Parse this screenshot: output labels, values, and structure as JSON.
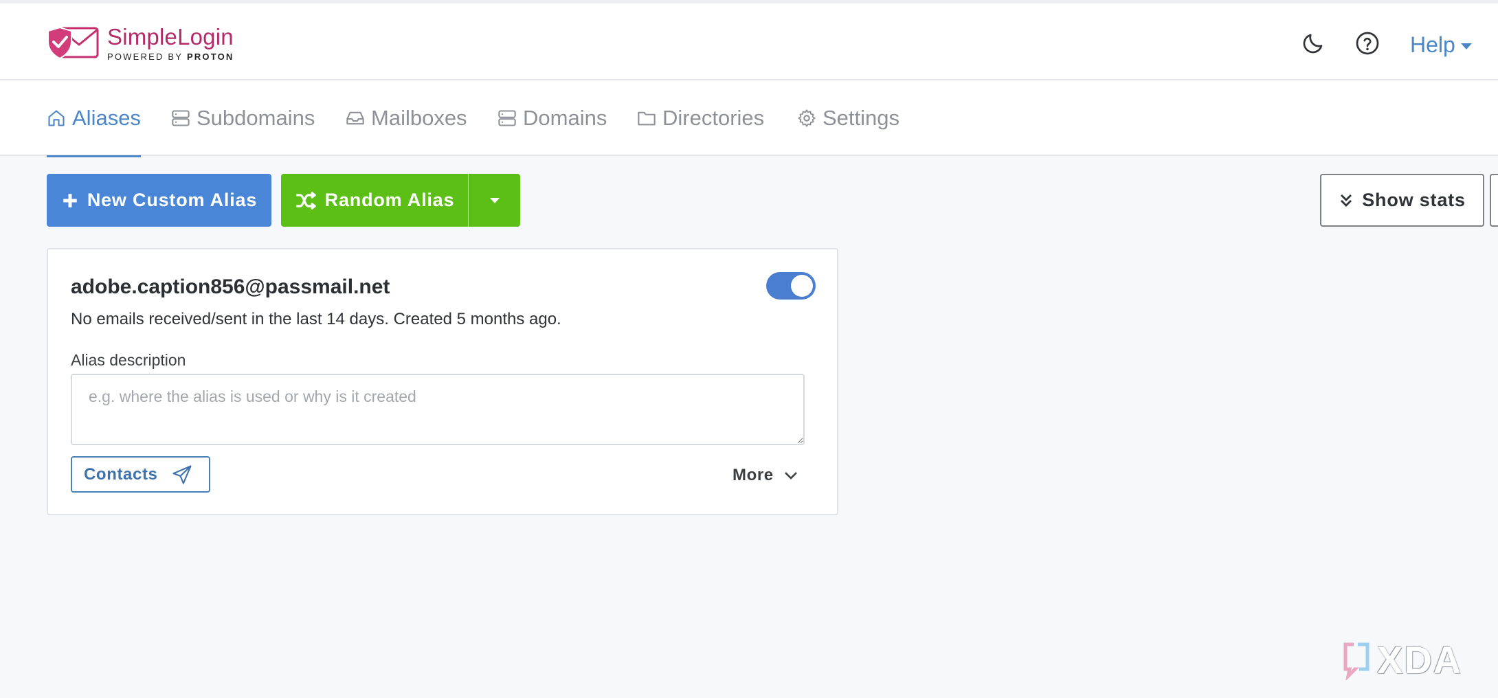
{
  "header": {
    "logo": {
      "name": "SimpleLogin",
      "sub_prefix": "POWERED BY",
      "sub_brand": "PROTON",
      "brand_color": "#b32a6a"
    },
    "icons": [
      "moon-icon",
      "question-circle-icon"
    ],
    "help_label": "Help"
  },
  "nav": {
    "tabs": [
      {
        "label": "Aliases",
        "icon": "home-icon",
        "active": true
      },
      {
        "label": "Subdomains",
        "icon": "server-icon",
        "active": false
      },
      {
        "label": "Mailboxes",
        "icon": "inbox-icon",
        "active": false
      },
      {
        "label": "Domains",
        "icon": "server-icon",
        "active": false
      },
      {
        "label": "Directories",
        "icon": "folder-icon",
        "active": false
      },
      {
        "label": "Settings",
        "icon": "gear-icon",
        "active": false
      }
    ],
    "accent_color": "#4a86c8"
  },
  "actions": {
    "new_custom_alias": "New Custom Alias",
    "random_alias": "Random Alias",
    "show_stats": "Show stats"
  },
  "alias_card": {
    "email": "adobe.caption856@passmail.net",
    "enabled": true,
    "info": "No emails received/sent in the last 14 days. Created 5 months ago.",
    "description_label": "Alias description",
    "description_placeholder": "e.g. where the alias is used or why is it created",
    "description_value": "",
    "contacts_label": "Contacts",
    "more_label": "More"
  },
  "watermark": {
    "text": "XDA"
  },
  "colors": {
    "primary_button": "#4a86d8",
    "random_button": "#5cbf16",
    "toggle_on": "#4a7fd0"
  }
}
